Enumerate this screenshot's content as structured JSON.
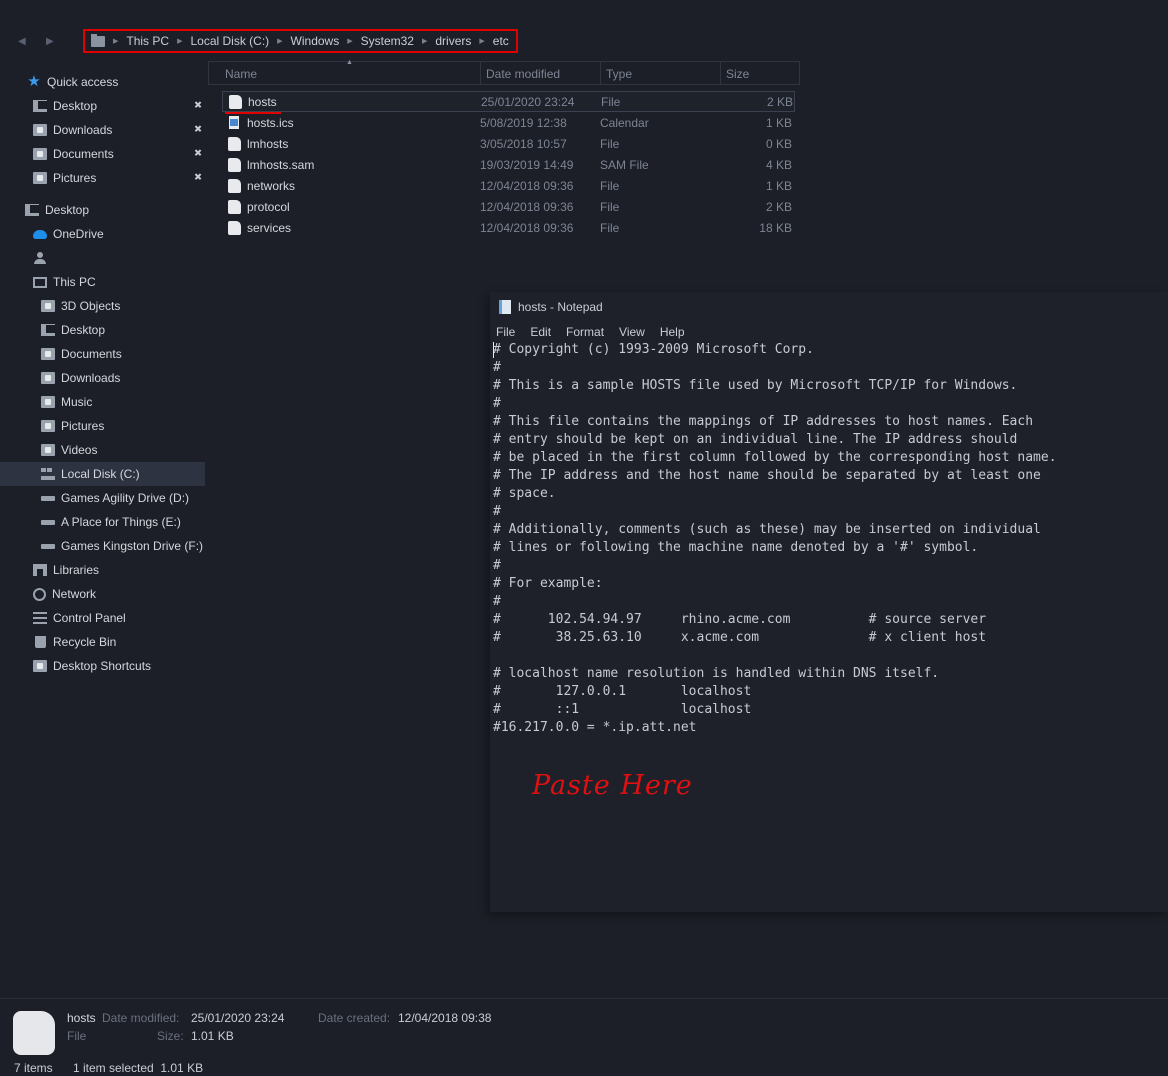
{
  "navigation": {
    "back_icon": "arrow-left",
    "forward_icon": "arrow-right"
  },
  "breadcrumb": {
    "highlight_color": "#e00000",
    "items": [
      "This PC",
      "Local Disk (C:)",
      "Windows",
      "System32",
      "drivers",
      "etc"
    ]
  },
  "sidebar": {
    "items": [
      {
        "label": "Quick access",
        "icon": "star-icon",
        "level": 0,
        "pinned": false
      },
      {
        "label": "Desktop",
        "icon": "desktop-icon",
        "level": 1,
        "pinned": true
      },
      {
        "label": "Downloads",
        "icon": "downloads-folder-icon",
        "level": 1,
        "pinned": true
      },
      {
        "label": "Documents",
        "icon": "documents-folder-icon",
        "level": 1,
        "pinned": true
      },
      {
        "label": "Pictures",
        "icon": "pictures-folder-icon",
        "level": 1,
        "pinned": true
      },
      {
        "label": "Desktop",
        "icon": "desktop-icon",
        "level": 0,
        "pinned": false
      },
      {
        "label": "OneDrive",
        "icon": "cloud-icon",
        "level": 1,
        "pinned": false
      },
      {
        "label": "",
        "icon": "user-icon",
        "level": 1,
        "pinned": false
      },
      {
        "label": "This PC",
        "icon": "computer-icon",
        "level": 1,
        "pinned": false
      },
      {
        "label": "3D Objects",
        "icon": "3d-objects-folder-icon",
        "level": 2,
        "pinned": false
      },
      {
        "label": "Desktop",
        "icon": "desktop-icon",
        "level": 2,
        "pinned": false
      },
      {
        "label": "Documents",
        "icon": "documents-folder-icon",
        "level": 2,
        "pinned": false
      },
      {
        "label": "Downloads",
        "icon": "downloads-folder-icon",
        "level": 2,
        "pinned": false
      },
      {
        "label": "Music",
        "icon": "music-folder-icon",
        "level": 2,
        "pinned": false
      },
      {
        "label": "Pictures",
        "icon": "pictures-folder-icon",
        "level": 2,
        "pinned": false
      },
      {
        "label": "Videos",
        "icon": "videos-folder-icon",
        "level": 2,
        "pinned": false
      },
      {
        "label": "Local Disk (C:)",
        "icon": "local-disk-icon",
        "level": 2,
        "pinned": false,
        "selected": true
      },
      {
        "label": "Games Agility Drive (D:)",
        "icon": "drive-icon",
        "level": 2,
        "pinned": false
      },
      {
        "label": "A Place for Things (E:)",
        "icon": "drive-icon",
        "level": 2,
        "pinned": false
      },
      {
        "label": "Games Kingston Drive (F:)",
        "icon": "drive-icon",
        "level": 2,
        "pinned": false
      },
      {
        "label": "Libraries",
        "icon": "libraries-icon",
        "level": 1,
        "pinned": false
      },
      {
        "label": "Network",
        "icon": "network-icon",
        "level": 1,
        "pinned": false
      },
      {
        "label": "Control Panel",
        "icon": "control-panel-icon",
        "level": 1,
        "pinned": false
      },
      {
        "label": "Recycle Bin",
        "icon": "recycle-bin-icon",
        "level": 1,
        "pinned": false
      },
      {
        "label": "Desktop Shortcuts",
        "icon": "folder-icon",
        "level": 1,
        "pinned": false
      }
    ]
  },
  "file_list": {
    "columns": [
      "Name",
      "Date modified",
      "Type",
      "Size"
    ],
    "sorted_by": "Name",
    "rows": [
      {
        "name": "hosts",
        "date": "25/01/2020 23:24",
        "type": "File",
        "size": "2 KB",
        "icon": "file-icon",
        "selected": true
      },
      {
        "name": "hosts.ics",
        "date": "5/08/2019 12:38",
        "type": "Calendar",
        "size": "1 KB",
        "icon": "calendar-file-icon"
      },
      {
        "name": "lmhosts",
        "date": "3/05/2018 10:57",
        "type": "File",
        "size": "0 KB",
        "icon": "file-icon"
      },
      {
        "name": "lmhosts.sam",
        "date": "19/03/2019 14:49",
        "type": "SAM File",
        "size": "4 KB",
        "icon": "file-icon"
      },
      {
        "name": "networks",
        "date": "12/04/2018 09:36",
        "type": "File",
        "size": "1 KB",
        "icon": "file-icon"
      },
      {
        "name": "protocol",
        "date": "12/04/2018 09:36",
        "type": "File",
        "size": "2 KB",
        "icon": "file-icon"
      },
      {
        "name": "services",
        "date": "12/04/2018 09:36",
        "type": "File",
        "size": "18 KB",
        "icon": "file-icon"
      }
    ]
  },
  "notepad": {
    "title": "hosts - Notepad",
    "menu": [
      "File",
      "Edit",
      "Format",
      "View",
      "Help"
    ],
    "content": "# Copyright (c) 1993-2009 Microsoft Corp.\n#\n# This is a sample HOSTS file used by Microsoft TCP/IP for Windows.\n#\n# This file contains the mappings of IP addresses to host names. Each\n# entry should be kept on an individual line. The IP address should\n# be placed in the first column followed by the corresponding host name.\n# The IP address and the host name should be separated by at least one\n# space.\n#\n# Additionally, comments (such as these) may be inserted on individual\n# lines or following the machine name denoted by a '#' symbol.\n#\n# For example:\n#\n#      102.54.94.97     rhino.acme.com          # source server\n#       38.25.63.10     x.acme.com              # x client host\n\n# localhost name resolution is handled within DNS itself.\n#\t127.0.0.1       localhost\n#\t::1             localhost\n#16.217.0.0 = *.ip.att.net",
    "annotation": "Paste Here",
    "annotation_color": "#e01010"
  },
  "details_pane": {
    "file_name": "hosts",
    "file_type": "File",
    "date_modified_label": "Date modified:",
    "date_modified": "25/01/2020 23:24",
    "size_label": "Size:",
    "size": "1.01 KB",
    "date_created_label": "Date created:",
    "date_created": "12/04/2018 09:38"
  },
  "status_bar": {
    "item_count": "7 items",
    "selection": "1 item selected  1.01 KB"
  }
}
